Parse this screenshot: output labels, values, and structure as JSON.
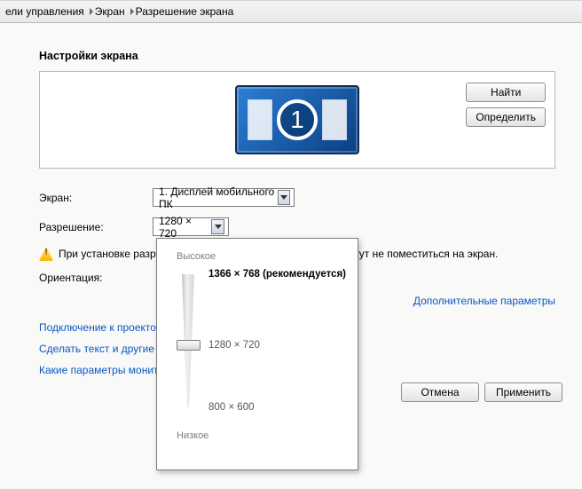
{
  "breadcrumb": {
    "item1": "ели управления",
    "item2": "Экран",
    "item3": "Разрешение экрана"
  },
  "heading": "Настройки экрана",
  "buttons": {
    "find": "Найти",
    "detect": "Определить",
    "cancel": "Отмена",
    "apply": "Применить"
  },
  "monitor_number": "1",
  "labels": {
    "screen": "Экран:",
    "resolution": "Разрешение:",
    "orientation": "Ориентация:"
  },
  "dropdowns": {
    "screen_value": "1. Дисплей мобильного ПК",
    "resolution_value": "1280 × 720"
  },
  "warning": {
    "text_left": "При установке разр",
    "text_right": "огут не поместиться на экран."
  },
  "links": {
    "advanced": "Дополнительные параметры",
    "projector": "Подключение к проекто",
    "textsize": "Сделать текст и другие",
    "monitor": "Какие параметры монит"
  },
  "popup": {
    "high": "Высокое",
    "low": "Низкое",
    "top": "1366 × 768 (рекомендуется)",
    "mid": "1280 × 720",
    "bot": "800 × 600"
  }
}
